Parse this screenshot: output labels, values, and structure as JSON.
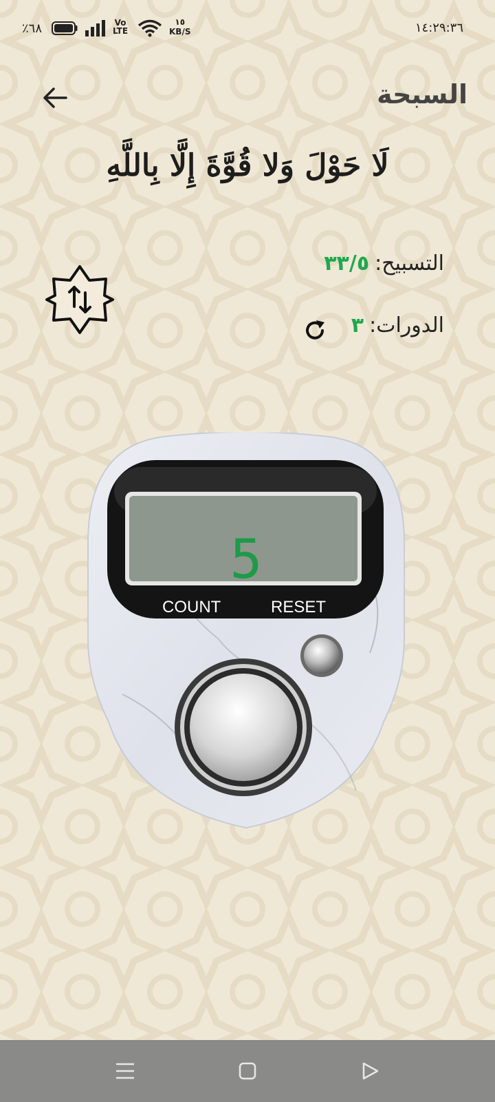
{
  "status_bar": {
    "time": "١٤:٢٩:٣٦",
    "battery": "٪٦٨",
    "volte_top": "Vo",
    "volte_bottom": "LTE",
    "net_speed_value": "١٥",
    "net_speed_unit": "KB/S"
  },
  "header": {
    "title": "السبحة"
  },
  "dhikr": {
    "text": "لَا حَوْلَ وَلا قُوَّةَ إِلَّا بِاللَّهِ"
  },
  "stats": {
    "tasbeeh_label": "التسبيح:",
    "tasbeeh_value": "٣٣/٥",
    "rounds_label": "الدورات:",
    "rounds_value": "٣"
  },
  "counter": {
    "display_value": "5",
    "count_label": "COUNT",
    "reset_label": "RESET"
  },
  "colors": {
    "accent": "#1ea84e",
    "background": "#f1e9d8"
  },
  "icons": {
    "back": "arrow-left-icon",
    "swap": "swap-vertical-icon",
    "refresh": "refresh-icon",
    "nav_menu": "menu-icon",
    "nav_home": "home-icon",
    "nav_back": "back-triangle-icon"
  }
}
